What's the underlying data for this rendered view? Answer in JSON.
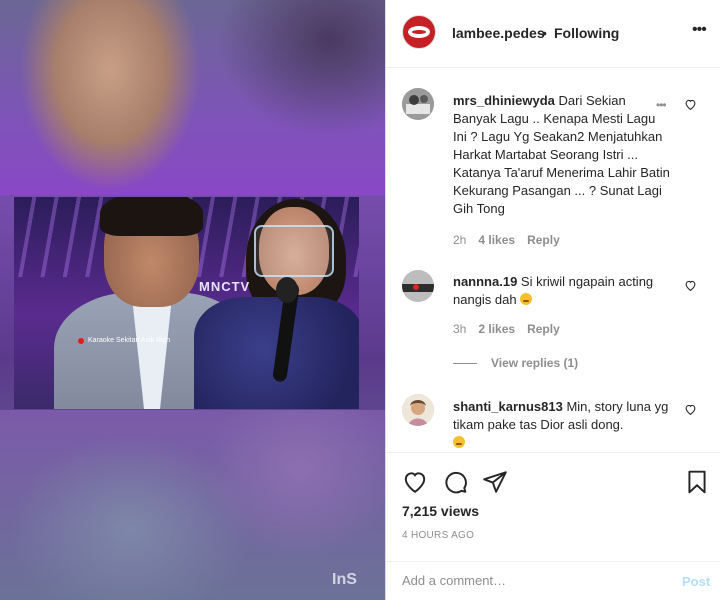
{
  "header": {
    "username": "lambee.pedes",
    "separator": "•",
    "follow_status": "Following",
    "more_label": "•••"
  },
  "media": {
    "channel_logo": "MNCTV",
    "live_caption": "Karaoke Sekitan Asik Rich",
    "watermark": "InS"
  },
  "comments": [
    {
      "username": "mrs_dhiniewyda",
      "text": "Dari Sekian Banyak Lagu .. Kenapa Mesti Lagu Ini ? Lagu Yg Seakan2 Menjatuhkan Harkat Martabat Seorang Istri ... Katanya Ta'aruf Menerima Lahir Batin Kekurang Pasangan ... ? Sunat Lagi Gih Tong",
      "time": "2h",
      "likes": "4 likes",
      "reply": "Reply",
      "more": "•••"
    },
    {
      "username": "nannna.19",
      "text": "Si kriwil ngapain acting nangis dah",
      "time": "3h",
      "likes": "2 likes",
      "reply": "Reply",
      "view_replies": "View replies (1)"
    },
    {
      "username": "shanti_karnus813",
      "text": "Min, story luna yg tikam pake tas Dior asli dong.",
      "time": "",
      "likes": "",
      "reply": ""
    }
  ],
  "stats": {
    "views": "7,215 views",
    "posted": "4 HOURS AGO"
  },
  "add_comment": {
    "placeholder": "Add a comment…",
    "post_label": "Post"
  },
  "colors": {
    "text": "#262626",
    "muted": "#8e8e8e",
    "post_disabled": "#b2dffc",
    "avatar_brand": "#c62026"
  }
}
